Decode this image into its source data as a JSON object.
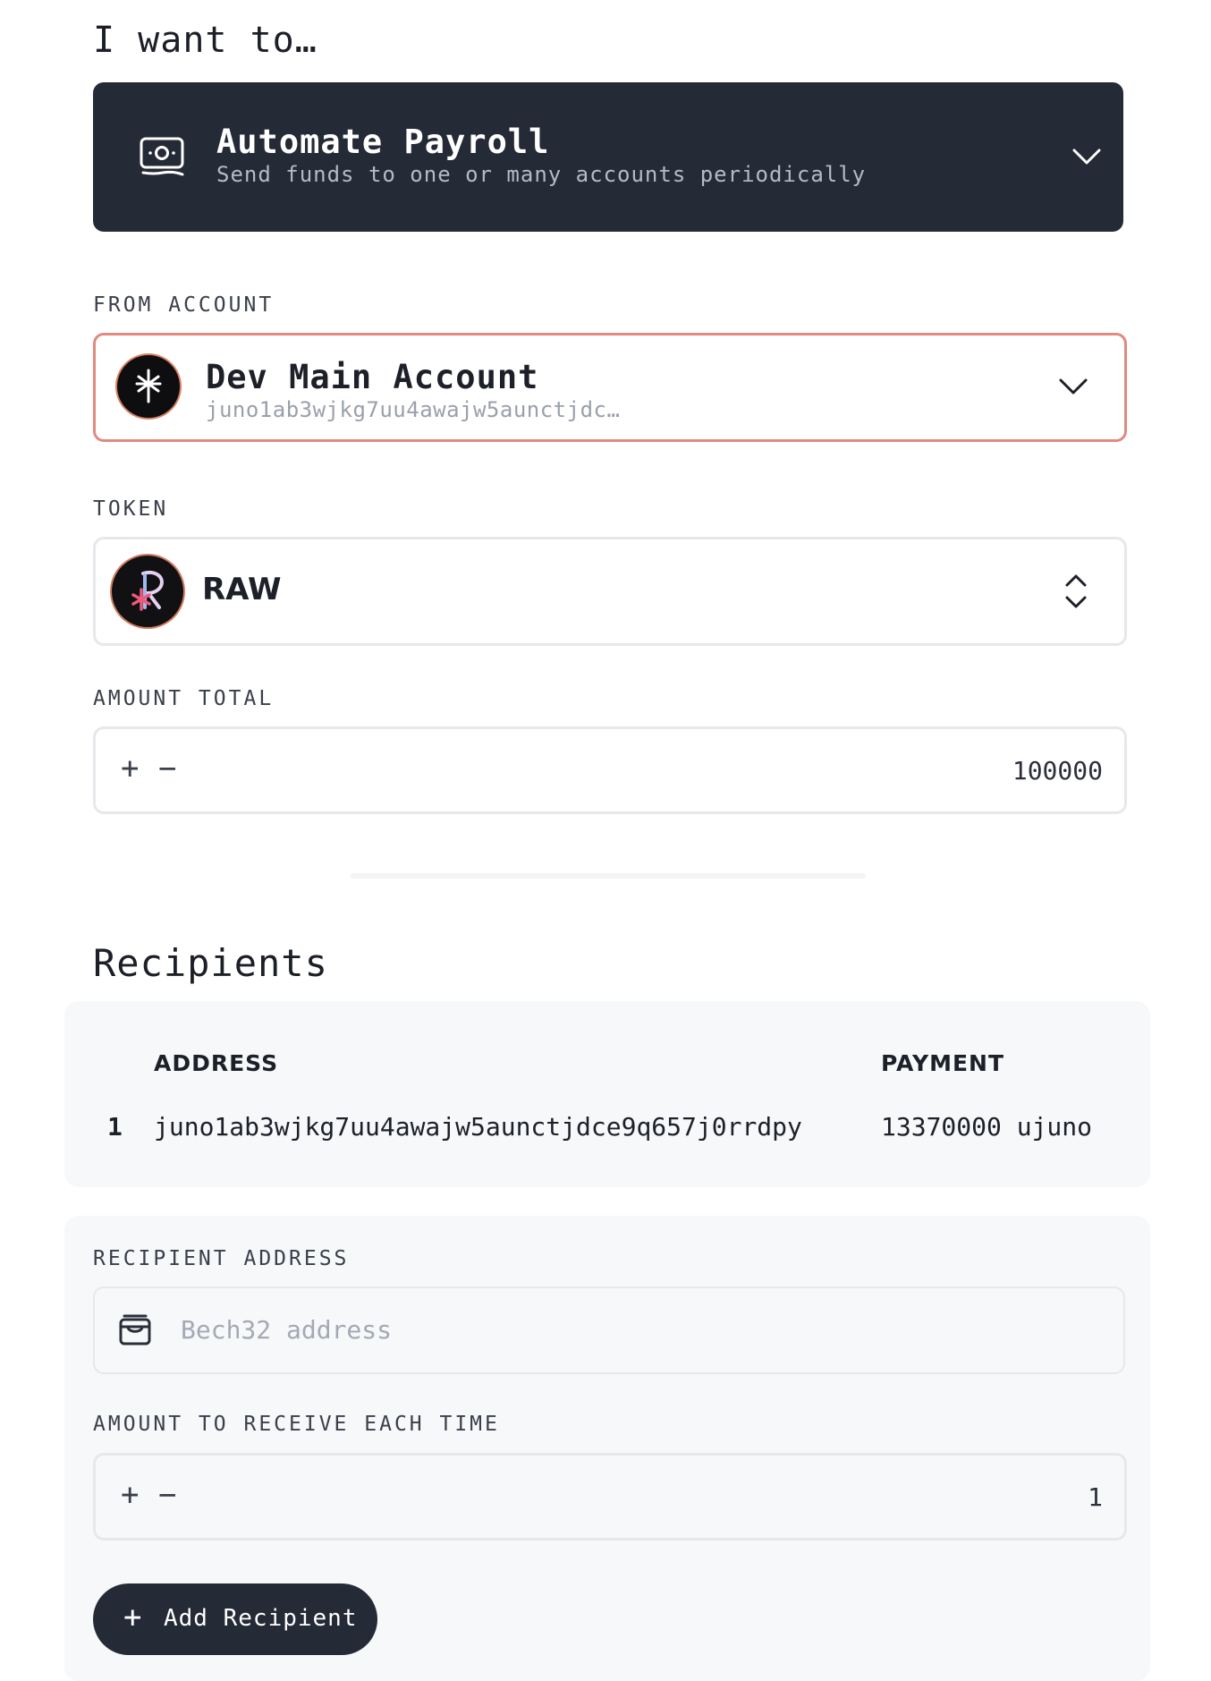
{
  "heading": "I want to…",
  "goal": {
    "title": "Automate Payroll",
    "subtitle": "Send funds to one or many accounts periodically",
    "icon": "money-icon"
  },
  "from_account": {
    "label": "FROM ACCOUNT",
    "name": "Dev Main Account",
    "address": "juno1ab3wjkg7uu4awajw5aunctjdc…",
    "icon": "juno-icon"
  },
  "token": {
    "label": "TOKEN",
    "name": "RAW",
    "icon": "raw-token-icon"
  },
  "amount_total": {
    "label": "AMOUNT TOTAL",
    "plus": "+",
    "minus": "−",
    "value": "100000"
  },
  "recipients": {
    "title": "Recipients",
    "columns": [
      "ADDRESS",
      "PAYMENT"
    ],
    "rows": [
      {
        "index": "1",
        "address": "juno1ab3wjkg7uu4awajw5aunctjdce9q657j0rrdpy",
        "payment": "13370000 ujuno"
      }
    ]
  },
  "add_form": {
    "address_label": "RECIPIENT ADDRESS",
    "address_placeholder": "Bech32 address",
    "address_value": "",
    "amount_label": "AMOUNT TO RECEIVE EACH TIME",
    "plus": "+",
    "minus": "−",
    "amount_value": "1",
    "add_button": "Add Recipient",
    "add_icon": "+"
  },
  "colors": {
    "dark": "#242a36",
    "error_border": "#e08a80",
    "panel": "#f7f8fa"
  }
}
